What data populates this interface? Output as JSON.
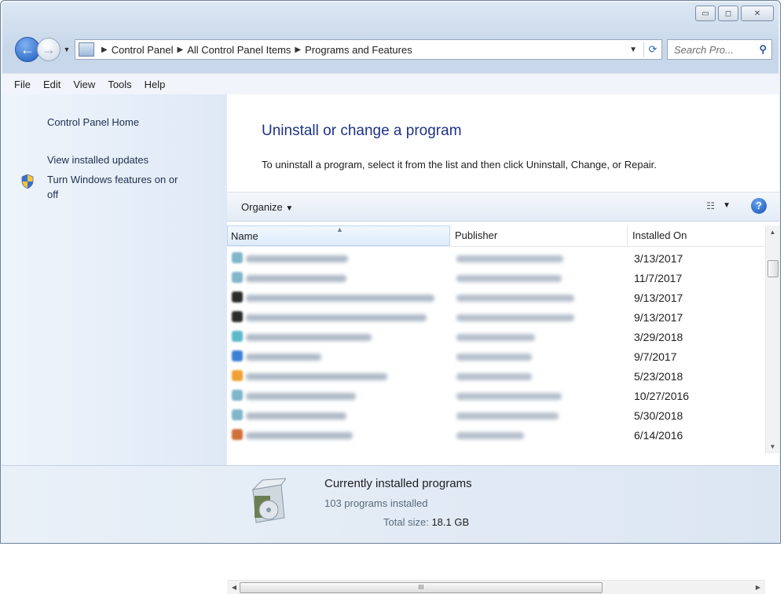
{
  "window": {
    "controls": {
      "minimize": "▭",
      "maximize": "◻",
      "close": "✕"
    }
  },
  "address": {
    "breadcrumbs": [
      "Control Panel",
      "All Control Panel Items",
      "Programs and Features"
    ],
    "search_placeholder": "Search Pro..."
  },
  "menu": [
    "File",
    "Edit",
    "View",
    "Tools",
    "Help"
  ],
  "sidebar": {
    "home": "Control Panel Home",
    "updates": "View installed updates",
    "features_line1": "Turn Windows features on or",
    "features_line2": "off"
  },
  "main": {
    "title": "Uninstall or change a program",
    "description": "To uninstall a program, select it from the list and then click Uninstall, Change, or Repair."
  },
  "toolbar": {
    "organize": "Organize",
    "help": "?"
  },
  "table": {
    "columns": [
      "Name",
      "Publisher",
      "Installed On"
    ],
    "rows": [
      {
        "installed": "3/13/2017",
        "icon_color": "#7fb6c9"
      },
      {
        "installed": "11/7/2017",
        "icon_color": "#7fb6c9"
      },
      {
        "installed": "9/13/2017",
        "icon_color": "#2b2b2b"
      },
      {
        "installed": "9/13/2017",
        "icon_color": "#2b2b2b"
      },
      {
        "installed": "3/29/2018",
        "icon_color": "#5bb8c8"
      },
      {
        "installed": "9/7/2017",
        "icon_color": "#3c7fd6"
      },
      {
        "installed": "5/23/2018",
        "icon_color": "#f0a030"
      },
      {
        "installed": "10/27/2016",
        "icon_color": "#7fb6c9"
      },
      {
        "installed": "5/30/2018",
        "icon_color": "#7fb6c9"
      },
      {
        "installed": "6/14/2016",
        "icon_color": "#d0703a"
      }
    ]
  },
  "details": {
    "title": "Currently installed programs",
    "count": "103 programs installed",
    "size_label": "Total size:",
    "size_value": "18.1 GB"
  },
  "colors": {
    "heading": "#1e3287",
    "accent": "#1d5bc1"
  }
}
